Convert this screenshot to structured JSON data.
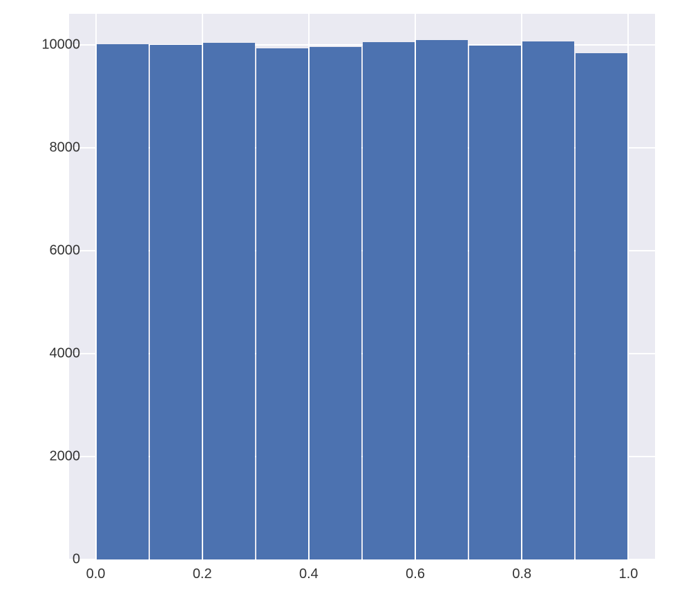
{
  "chart_data": {
    "type": "bar",
    "categories": [
      0.05,
      0.15,
      0.25,
      0.35,
      0.45,
      0.55,
      0.65,
      0.75,
      0.85,
      0.95
    ],
    "bin_edges": [
      0.0,
      0.1,
      0.2,
      0.3,
      0.4,
      0.5,
      0.6,
      0.7,
      0.8,
      0.9,
      1.0
    ],
    "values": [
      10010,
      9990,
      10030,
      9930,
      9950,
      10050,
      10090,
      9980,
      10060,
      9830
    ],
    "title": "",
    "xlabel": "",
    "ylabel": "",
    "xlim": [
      -0.05,
      1.05
    ],
    "ylim": [
      0,
      10600
    ],
    "x_ticks": [
      0.0,
      0.2,
      0.4,
      0.6,
      0.8,
      1.0
    ],
    "x_tick_labels": [
      "0.0",
      "0.2",
      "0.4",
      "0.6",
      "0.8",
      "1.0"
    ],
    "y_ticks": [
      0,
      2000,
      4000,
      6000,
      8000,
      10000
    ],
    "y_tick_labels": [
      "0",
      "2000",
      "4000",
      "6000",
      "8000",
      "10000"
    ],
    "bar_color": "#4C72B0",
    "background_color": "#EAEAF2",
    "grid": true
  }
}
